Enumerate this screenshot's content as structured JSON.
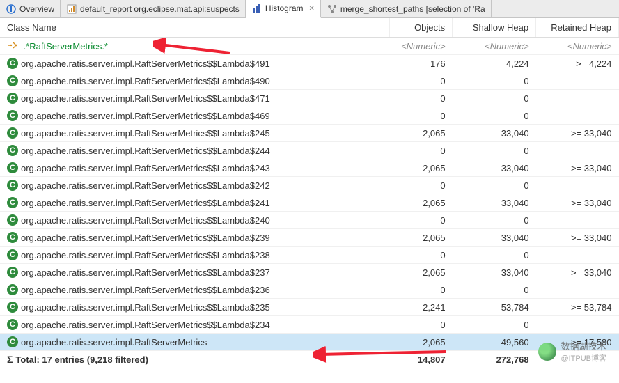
{
  "tabs": [
    {
      "label": "Overview",
      "iconColor": "#2a6fcf",
      "active": false
    },
    {
      "label": "default_report org.eclipse.mat.api:suspects",
      "iconColor": "#d08a2a",
      "active": false
    },
    {
      "label": "Histogram",
      "iconColor": "#3a5fb5",
      "active": true,
      "closable": true
    },
    {
      "label": "merge_shortest_paths [selection of 'Ra",
      "iconColor": "#888",
      "active": false
    }
  ],
  "columns": {
    "class": "Class Name",
    "objects": "Objects",
    "shallow": "Shallow Heap",
    "retained": "Retained Heap"
  },
  "filter": {
    "regex": ".*RaftServerMetrics.*",
    "placeholder": "<Numeric>"
  },
  "rows": [
    {
      "class": "org.apache.ratis.server.impl.RaftServerMetrics$$Lambda$491",
      "objects": "176",
      "shallow": "4,224",
      "retained": ">= 4,224"
    },
    {
      "class": "org.apache.ratis.server.impl.RaftServerMetrics$$Lambda$490",
      "objects": "0",
      "shallow": "0",
      "retained": ""
    },
    {
      "class": "org.apache.ratis.server.impl.RaftServerMetrics$$Lambda$471",
      "objects": "0",
      "shallow": "0",
      "retained": ""
    },
    {
      "class": "org.apache.ratis.server.impl.RaftServerMetrics$$Lambda$469",
      "objects": "0",
      "shallow": "0",
      "retained": ""
    },
    {
      "class": "org.apache.ratis.server.impl.RaftServerMetrics$$Lambda$245",
      "objects": "2,065",
      "shallow": "33,040",
      "retained": ">= 33,040"
    },
    {
      "class": "org.apache.ratis.server.impl.RaftServerMetrics$$Lambda$244",
      "objects": "0",
      "shallow": "0",
      "retained": ""
    },
    {
      "class": "org.apache.ratis.server.impl.RaftServerMetrics$$Lambda$243",
      "objects": "2,065",
      "shallow": "33,040",
      "retained": ">= 33,040"
    },
    {
      "class": "org.apache.ratis.server.impl.RaftServerMetrics$$Lambda$242",
      "objects": "0",
      "shallow": "0",
      "retained": ""
    },
    {
      "class": "org.apache.ratis.server.impl.RaftServerMetrics$$Lambda$241",
      "objects": "2,065",
      "shallow": "33,040",
      "retained": ">= 33,040"
    },
    {
      "class": "org.apache.ratis.server.impl.RaftServerMetrics$$Lambda$240",
      "objects": "0",
      "shallow": "0",
      "retained": ""
    },
    {
      "class": "org.apache.ratis.server.impl.RaftServerMetrics$$Lambda$239",
      "objects": "2,065",
      "shallow": "33,040",
      "retained": ">= 33,040"
    },
    {
      "class": "org.apache.ratis.server.impl.RaftServerMetrics$$Lambda$238",
      "objects": "0",
      "shallow": "0",
      "retained": ""
    },
    {
      "class": "org.apache.ratis.server.impl.RaftServerMetrics$$Lambda$237",
      "objects": "2,065",
      "shallow": "33,040",
      "retained": ">= 33,040"
    },
    {
      "class": "org.apache.ratis.server.impl.RaftServerMetrics$$Lambda$236",
      "objects": "0",
      "shallow": "0",
      "retained": ""
    },
    {
      "class": "org.apache.ratis.server.impl.RaftServerMetrics$$Lambda$235",
      "objects": "2,241",
      "shallow": "53,784",
      "retained": ">= 53,784"
    },
    {
      "class": "org.apache.ratis.server.impl.RaftServerMetrics$$Lambda$234",
      "objects": "0",
      "shallow": "0",
      "retained": ""
    },
    {
      "class": "org.apache.ratis.server.impl.RaftServerMetrics",
      "objects": "2,065",
      "shallow": "49,560",
      "retained": ">= 17,580",
      "selected": true
    }
  ],
  "total": {
    "label": "Total: 17 entries (9,218 filtered)",
    "objects": "14,807",
    "shallow": "272,768",
    "retained": ""
  },
  "watermark": {
    "text": "数据湖技术",
    "sub": "@ITPUB博客"
  }
}
